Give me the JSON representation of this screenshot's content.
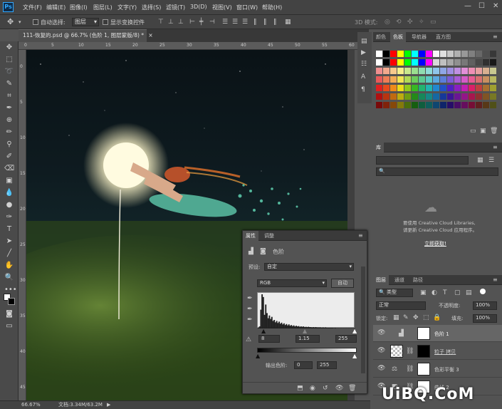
{
  "app": {
    "logo": "Ps"
  },
  "menu": [
    "文件(F)",
    "编辑(E)",
    "图像(I)",
    "图层(L)",
    "文字(Y)",
    "选择(S)",
    "滤镜(T)",
    "3D(D)",
    "视图(V)",
    "窗口(W)",
    "帮助(H)"
  ],
  "window_controls": [
    "—",
    "☐",
    "✕"
  ],
  "options": {
    "auto_select_label": "自动选择:",
    "auto_select_value": "图层",
    "show_transform_label": "显示变换控件",
    "mode_label": "3D 模式:"
  },
  "document": {
    "tab_title": "111-恢复的.psd @ 66.7% (色阶 1, 图层蒙版/8) *",
    "close": "×"
  },
  "rulers": {
    "top": [
      "0",
      "5",
      "10",
      "15",
      "20",
      "25",
      "30",
      "35",
      "40",
      "45",
      "50",
      "55",
      "60"
    ],
    "left": [
      "0",
      "5",
      "10",
      "15",
      "20",
      "25",
      "30",
      "35",
      "40",
      "45"
    ]
  },
  "status": {
    "zoom": "66.67%",
    "doc_info": "文档:3.34M/63.2M"
  },
  "swatches_panel": {
    "tabs": [
      "颜色",
      "色板",
      "导航器",
      "直方图"
    ],
    "rows": [
      [
        "#ffffff",
        "#000000",
        "#ff0000",
        "#ffff00",
        "#00ff00",
        "#00ffff",
        "#0000ff",
        "#ff00ff",
        "#f7f7f7",
        "#e0e0e0",
        "#c8c8c8",
        "#b0b0b0",
        "#989898",
        "#808080",
        "#686868",
        "#505050",
        "#383838"
      ],
      [
        "#ffffff",
        "#000000",
        "#ff0000",
        "#ffff00",
        "#00ff00",
        "#00ffff",
        "#0000ff",
        "#ff00ff",
        "#d8d8d8",
        "#c0c0c0",
        "#a8a8a8",
        "#909090",
        "#787878",
        "#606060",
        "#484848",
        "#303030",
        "#181818"
      ],
      [
        "#ef8f8f",
        "#f3a98d",
        "#f7c98c",
        "#f6ef8c",
        "#c9e88c",
        "#9adf8f",
        "#8fdcb0",
        "#8fdbd9",
        "#8fc5ea",
        "#8fa6e6",
        "#a08fe3",
        "#c08fe2",
        "#e28fd8",
        "#ee8fb5",
        "#e6a0a0",
        "#d8b090",
        "#c8c890"
      ],
      [
        "#e85a5a",
        "#ee7e56",
        "#f2aa55",
        "#f0e455",
        "#b0d957",
        "#6bcc5c",
        "#5cc992",
        "#5cc9c5",
        "#5ca9df",
        "#5c7ed9",
        "#7c5cd6",
        "#a85cd5",
        "#d55cc7",
        "#e65c93",
        "#d87070",
        "#c89060",
        "#b8b860"
      ],
      [
        "#e02020",
        "#e84a1c",
        "#ee8a1a",
        "#ecdc1a",
        "#90c81c",
        "#38b822",
        "#22b470",
        "#22b4b0",
        "#2288d0",
        "#2250c8",
        "#5020c4",
        "#8a20c2",
        "#c220b2",
        "#da2068",
        "#c04040",
        "#a87030",
        "#a0a030"
      ],
      [
        "#b01010",
        "#b83410",
        "#c06a10",
        "#bcac10",
        "#6e9c12",
        "#248a18",
        "#16885a",
        "#168886",
        "#1668a2",
        "#16389a",
        "#3a1696",
        "#6a1694",
        "#941688",
        "#a8164e",
        "#903030",
        "#805424",
        "#787824"
      ],
      [
        "#780a0a",
        "#80220a",
        "#86480a",
        "#847a0a",
        "#4a6e0c",
        "#165e10",
        "#0e5e3e",
        "#0e5e5c",
        "#0e4670",
        "#0e246a",
        "#260e68",
        "#480e66",
        "#660e5e",
        "#760e36",
        "#602020",
        "#583818",
        "#505018"
      ]
    ]
  },
  "library_panel": {
    "tab": "库",
    "message_line1": "要使用 Creative Cloud Libraries,",
    "message_line2": "请更新 Creative Cloud 应用程序。",
    "update_button": "立即获取!"
  },
  "layers_panel": {
    "tabs": [
      "图层",
      "通道",
      "路径"
    ],
    "filter": "类型",
    "blend_mode": "正常",
    "opacity_label": "不透明度:",
    "opacity": "100%",
    "lock_label": "锁定:",
    "fill_label": "填充:",
    "fill": "100%",
    "layers": [
      {
        "name": "色阶 1"
      },
      {
        "name": "粒子 拷贝"
      },
      {
        "name": "色彩平衡 3"
      },
      {
        "name": "曲线 2"
      }
    ]
  },
  "properties_panel": {
    "tabs": [
      "属性",
      "调整"
    ],
    "title": "色阶",
    "preset_label": "预设:",
    "preset_value": "自定",
    "channel": "RGB",
    "auto_button": "自动",
    "input_black": "8",
    "input_gamma": "1.15",
    "input_white": "255",
    "output_label": "输出色阶:",
    "output_black": "0",
    "output_white": "255",
    "histogram": [
      2,
      6,
      55,
      100,
      92,
      40,
      70,
      45,
      30,
      38,
      28,
      34,
      22,
      25,
      18,
      22,
      16,
      20,
      14,
      17,
      12,
      15,
      10,
      13,
      9,
      12,
      8,
      10,
      7,
      9,
      6,
      8,
      6,
      7,
      5,
      6,
      5,
      6,
      4,
      5,
      4,
      5,
      4,
      4,
      3,
      4,
      3,
      4,
      3,
      3,
      3,
      3,
      2,
      3,
      2,
      3,
      2,
      2,
      2,
      2,
      2,
      2,
      1,
      2,
      1,
      1,
      1,
      1,
      1,
      1,
      1,
      1,
      1,
      1,
      1,
      1,
      1,
      1,
      1,
      1
    ]
  },
  "watermark": "UiBQ.CoM"
}
